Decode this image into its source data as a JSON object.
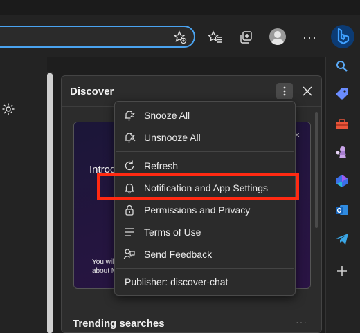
{
  "browser": {
    "accent": "#4aa3f0",
    "toolbar_icons": [
      "add-favorite-icon",
      "favorites-icon",
      "collections-icon",
      "profile-avatar",
      "more-icon",
      "bing-copilot-icon"
    ],
    "more_label": "···"
  },
  "sidebar_rail": {
    "icons": [
      "search-icon",
      "shopping-tag-icon",
      "tools-icon",
      "games-icon",
      "microsoft-365-icon",
      "outlook-icon",
      "telegram-icon",
      "add-icon"
    ]
  },
  "discover_pane": {
    "title": "Discover",
    "card": {
      "title_partial": "Introd",
      "text_line1": "You will",
      "text_line2": "about M",
      "close_glyph": "×"
    },
    "trending_title": "Trending searches",
    "trending_more": "···"
  },
  "context_menu": {
    "items": [
      {
        "label": "Snooze All",
        "icon": "snooze-icon"
      },
      {
        "label": "Unsnooze All",
        "icon": "unsnooze-icon"
      },
      {
        "label": "Refresh",
        "icon": "refresh-icon"
      },
      {
        "label": "Notification and App Settings",
        "icon": "bell-icon",
        "highlighted": true
      },
      {
        "label": "Permissions and Privacy",
        "icon": "lock-icon"
      },
      {
        "label": "Terms of Use",
        "icon": "list-icon"
      },
      {
        "label": "Send Feedback",
        "icon": "feedback-icon"
      }
    ],
    "publisher": "Publisher: discover-chat",
    "highlight_color": "#ff2a12"
  }
}
